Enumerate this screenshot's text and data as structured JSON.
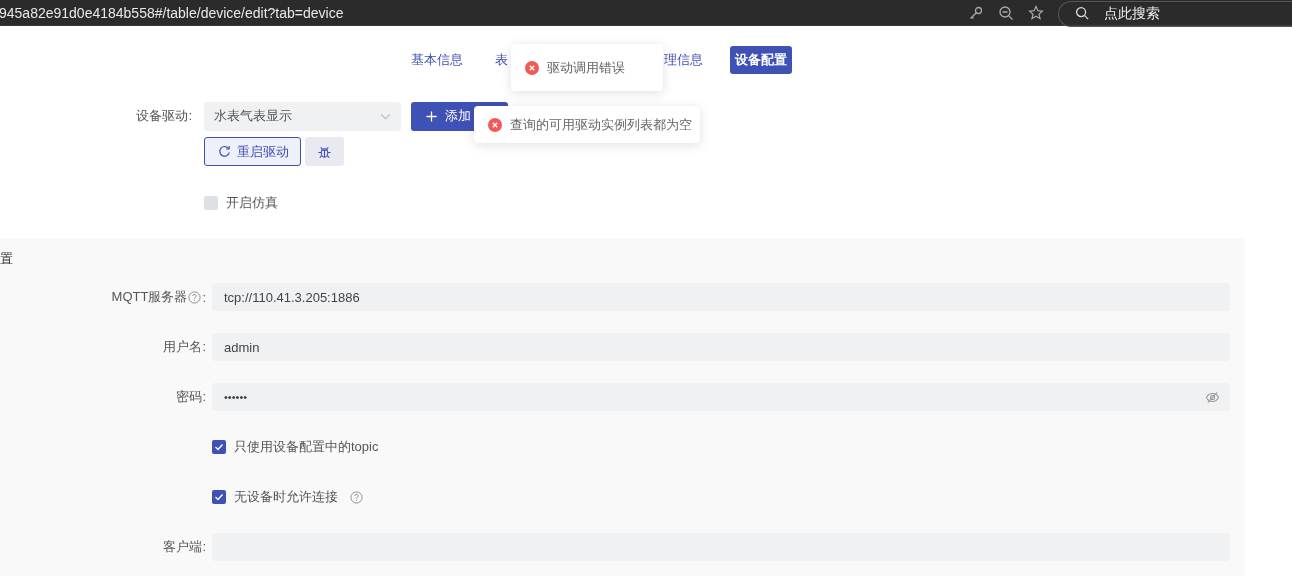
{
  "browser": {
    "url": "945a82e91d0e4184b558#/table/device/edit?tab=device",
    "search_placeholder": "点此搜索"
  },
  "tabs": [
    {
      "label": "基本信息",
      "selected": false
    },
    {
      "label": "表",
      "selected": false
    },
    {
      "label": "理信息",
      "selected": false
    },
    {
      "label": "设备配置",
      "selected": true
    }
  ],
  "driver": {
    "label": "设备驱动:",
    "value": "水表气表显示",
    "add_button": "添加",
    "restart_button": "重启驱动"
  },
  "simulation": {
    "label": "开启仿真",
    "checked": false
  },
  "section": {
    "title": "置",
    "fields": [
      {
        "kind": "text",
        "label": "MQTT服务器",
        "help": true,
        "label_suffix": ":",
        "value": "tcp://110.41.3.205:1886"
      },
      {
        "kind": "text",
        "label": "用户名:",
        "value": "admin"
      },
      {
        "kind": "password",
        "label": "密码:",
        "value": "••••••"
      },
      {
        "kind": "checkbox",
        "label": "只使用设备配置中的topic",
        "checked": true
      },
      {
        "kind": "checkbox",
        "label": "无设备时允许连接",
        "checked": true,
        "help": true
      },
      {
        "kind": "text",
        "label": "客户端:"
      }
    ]
  },
  "toasts": [
    {
      "text": "驱动调用错误"
    },
    {
      "text": "查询的可用驱动实例列表都为空"
    }
  ]
}
